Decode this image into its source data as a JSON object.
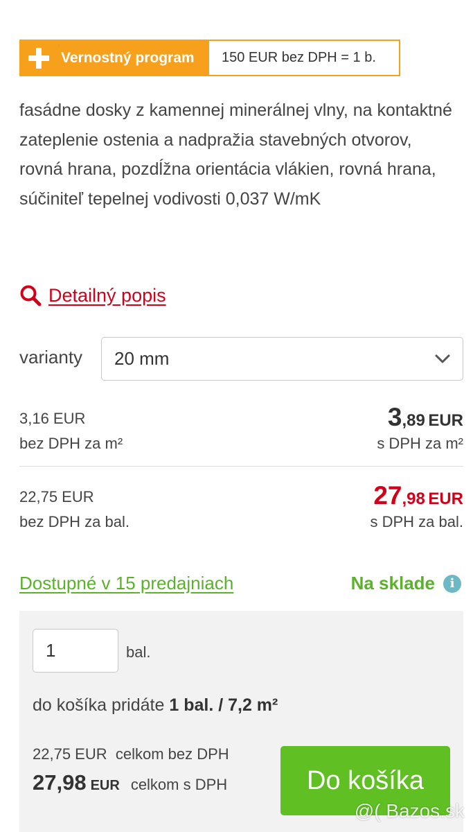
{
  "loyalty": {
    "title": "Vernostný program",
    "rule": "150 EUR bez DPH = 1 b."
  },
  "description": "fasádne dosky z kamennej minerálnej vlny, na kontaktné zateplenie ostenia a nadpražia stavebných otvorov, rovná hrana, pozdĺžna orientácia vlákien, rovná hrana, súčiniteľ tepelnej vodivosti 0,037 W/mK",
  "detail_link": "Detailný popis",
  "variant": {
    "label": "varianty",
    "selected": "20 mm"
  },
  "prices": {
    "per_m2": {
      "net": "3,16 EUR",
      "net_label": "bez DPH za m²",
      "gross_int": "3",
      "gross_dec": ",89",
      "gross_cur": "EUR",
      "gross_label": "s DPH za m²"
    },
    "per_pack": {
      "net": "22,75 EUR",
      "net_label": "bez DPH za bal.",
      "gross_int": "27",
      "gross_dec": ",98",
      "gross_cur": "EUR",
      "gross_label": "s DPH za bal."
    }
  },
  "availability": {
    "stores_link": "Dostupné v 15 predajniach",
    "stock": "Na sklade"
  },
  "cart": {
    "quantity": "1",
    "unit": "bal.",
    "summary_prefix": "do košíka pridáte",
    "summary_amount": "1 bal. / 7,2 m²",
    "net_total": "22,75 EUR",
    "net_total_label": "celkom bez DPH",
    "gross_total": "27,98",
    "gross_total_cur": "EUR",
    "gross_total_label": "celkom s DPH",
    "button": "Do košíka"
  },
  "watermark": "Bazos.sk",
  "colors": {
    "orange": "#f7a01b",
    "red": "#d0021b",
    "green": "#5ab22a",
    "button_green": "#5fbf23",
    "info": "#6cb8c4"
  }
}
